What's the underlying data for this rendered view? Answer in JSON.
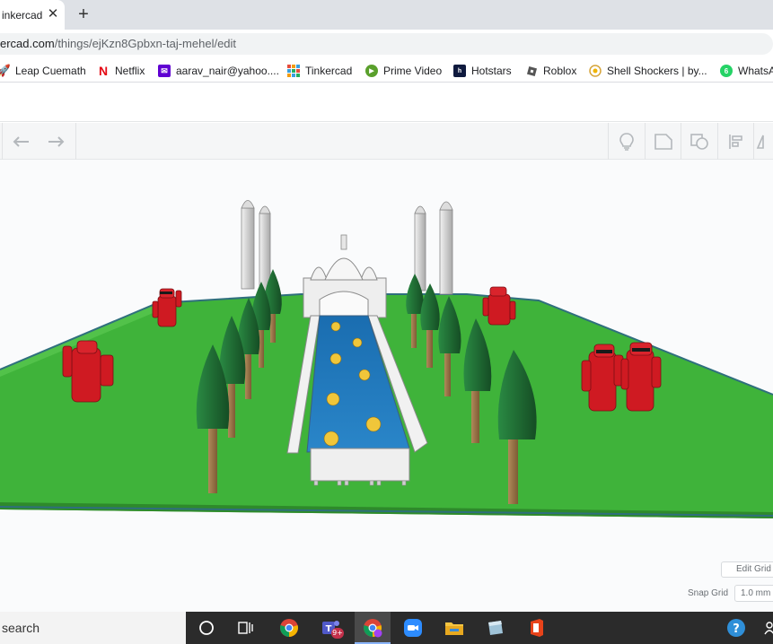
{
  "browser": {
    "tab_title": "inkercad",
    "tab_close": "✕",
    "new_tab": "+",
    "url_host": "ercad.com",
    "url_path": "/things/ejKzn8Gpbxn-taj-mehel/edit"
  },
  "bookmarks": [
    {
      "label": "Leap Cuemath",
      "icon": "rocket-icon",
      "color": "#2f80ed"
    },
    {
      "label": "Netflix",
      "icon": "netflix-icon",
      "color": "#e50914"
    },
    {
      "label": "aarav_nair@yahoo....",
      "icon": "yahoo-mail-icon",
      "color": "#6001d2"
    },
    {
      "label": "Tinkercad",
      "icon": "tinkercad-icon",
      "color": "#3aa0e0"
    },
    {
      "label": "Prime Video",
      "icon": "prime-video-icon",
      "color": "#5aa02c"
    },
    {
      "label": "Hotstars",
      "icon": "hotstar-icon",
      "color": "#0f1a3e"
    },
    {
      "label": "Roblox",
      "icon": "roblox-icon",
      "color": "#555555"
    },
    {
      "label": "Shell Shockers | by...",
      "icon": "egg-icon",
      "color": "#d6a43a"
    },
    {
      "label": "WhatsA",
      "icon": "whatsapp-icon",
      "color": "#25d366"
    }
  ],
  "toolbar": {
    "undo_icon": "undo-icon",
    "redo_icon": "redo-icon",
    "right_icons": [
      "lightbulb-icon",
      "note-icon",
      "shape-icon",
      "align-icon",
      "mirror-icon"
    ]
  },
  "workplane": {
    "edit_grid": "Edit Grid",
    "snap_grid_label": "Snap Grid",
    "snap_grid_value": "1.0 mm",
    "ground_color": "#3fb33a",
    "water_color": "#1e73b8",
    "tree_color": "#1f6b33",
    "figure_color": "#d11a22"
  },
  "taskbar": {
    "search_placeholder": "search",
    "apps": [
      "cortana-icon",
      "task-view-icon",
      "chrome-icon",
      "teams-icon",
      "chrome-profile-icon",
      "zoom-icon",
      "file-explorer-icon",
      "app-icon",
      "office-icon"
    ],
    "teams_badge": "9+",
    "tray": [
      "help-icon",
      "people-icon"
    ]
  }
}
